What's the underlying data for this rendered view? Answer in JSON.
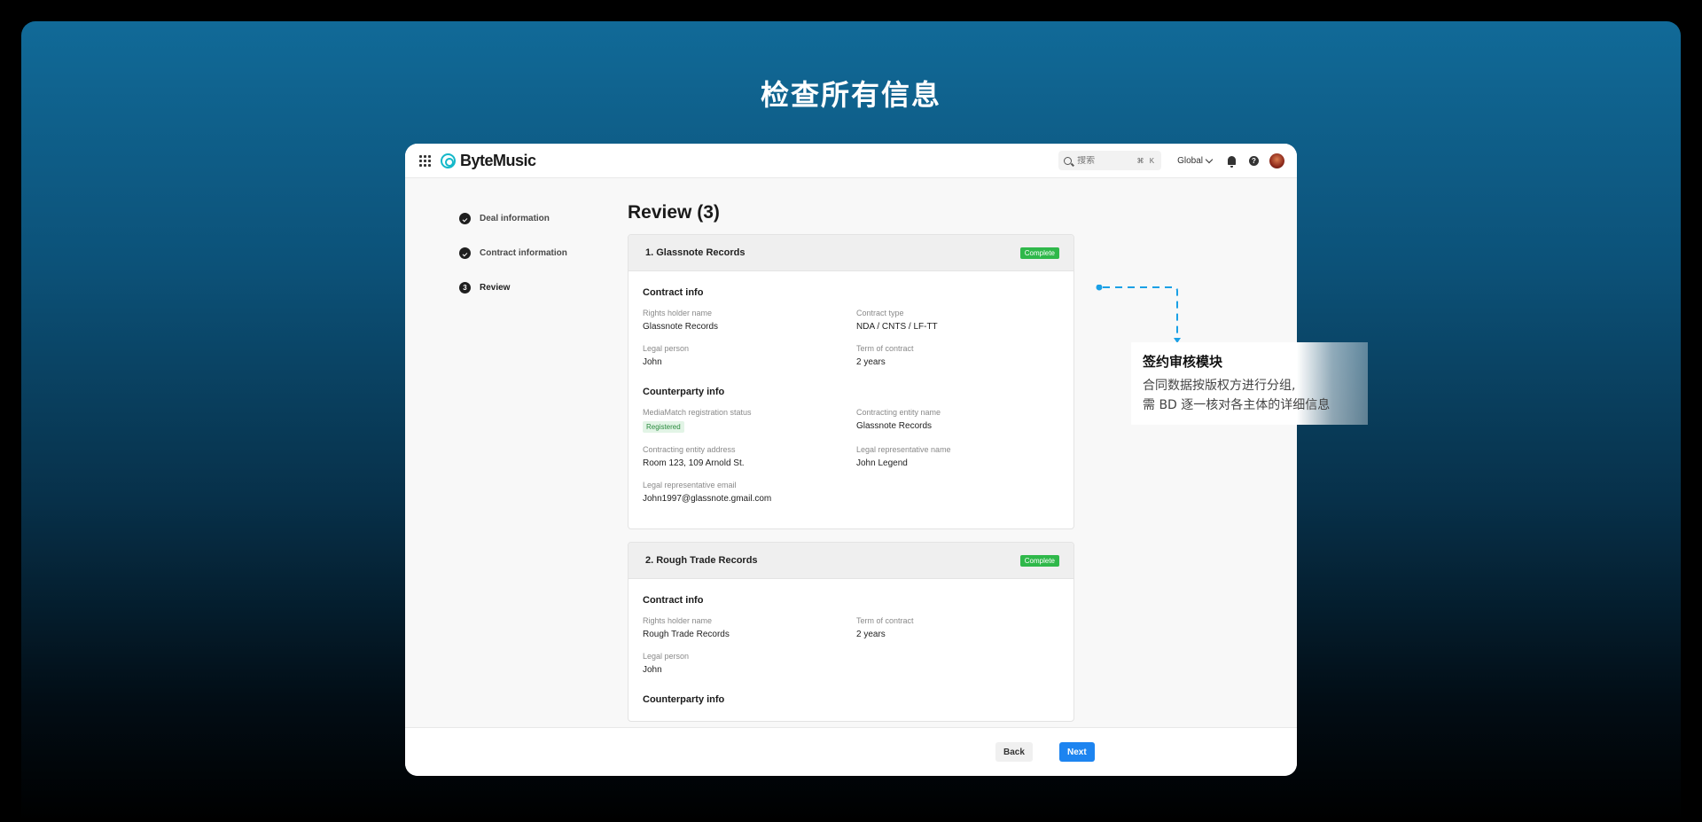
{
  "headline": "检查所有信息",
  "app": {
    "brand": "ByteMusic",
    "search": {
      "placeholder": "搜索",
      "shortcut": "⌘ K"
    },
    "region": "Global"
  },
  "steps": [
    {
      "label": "Deal information",
      "state": "done"
    },
    {
      "label": "Contract information",
      "state": "done"
    },
    {
      "label": "Review",
      "state": "current",
      "number": "3"
    }
  ],
  "page_title": "Review (3)",
  "cards": [
    {
      "title": "1. Glassnote Records",
      "status": "Complete",
      "contract_section": "Contract info",
      "contract_fields": [
        {
          "label": "Rights holder name",
          "value": "Glassnote Records"
        },
        {
          "label": "Contract type",
          "value": "NDA / CNTS / LF-TT"
        },
        {
          "label": "Legal person",
          "value": "John"
        },
        {
          "label": "Term of contract",
          "value": "2 years"
        }
      ],
      "counterparty_section": "Counterparty info",
      "counterparty_fields": [
        {
          "label": "MediaMatch registration status",
          "value": "Registered"
        },
        {
          "label": "Contracting entity name",
          "value": "Glassnote Records"
        },
        {
          "label": "Contracting entity address",
          "value": "Room 123, 109 Arnold St."
        },
        {
          "label": "Legal representative name",
          "value": "John Legend"
        },
        {
          "label": "Legal representative email",
          "value": "John1997@glassnote.gmail.com"
        }
      ]
    },
    {
      "title": "2. Rough Trade Records",
      "status": "Complete",
      "contract_section": "Contract info",
      "contract_fields": [
        {
          "label": "Rights holder name",
          "value": "Rough Trade Records"
        },
        {
          "label": "Term of contract",
          "value": "2 years"
        },
        {
          "label": "Legal person",
          "value": "John"
        }
      ],
      "counterparty_section": "Counterparty info"
    }
  ],
  "footer": {
    "back_label": "Back",
    "next_label": "Next"
  },
  "annotation": {
    "title": "签约审核模块",
    "line1": "合同数据按版权方进行分组,",
    "line2": "需 BD 逐一核对各主体的详细信息"
  },
  "colors": {
    "accent": "#1d84f0",
    "complete_badge": "#2fb84a",
    "connector": "#1aa0e6",
    "logo": "#14b8c9"
  }
}
